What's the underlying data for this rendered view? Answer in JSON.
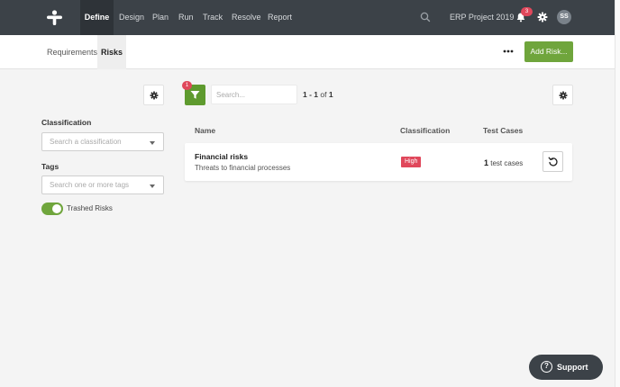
{
  "nav": {
    "items": [
      {
        "label": "Define",
        "active": true
      },
      {
        "label": "Design",
        "active": false
      },
      {
        "label": "Plan",
        "active": false
      },
      {
        "label": "Run",
        "active": false
      },
      {
        "label": "Track",
        "active": false
      },
      {
        "label": "Resolve",
        "active": false
      },
      {
        "label": "Report",
        "active": false
      }
    ],
    "project": "ERP Project 2019",
    "notifications": "3",
    "avatar_initials": "SS",
    "icons": [
      "logo-icon",
      "search-icon",
      "bell-icon",
      "gear-icon"
    ]
  },
  "subheader": {
    "tabs": [
      {
        "label": "Requirements",
        "active": false
      },
      {
        "label": "Risks",
        "active": true
      }
    ],
    "add_label": "Add Risk..."
  },
  "filters": {
    "classification_label": "Classification",
    "classification_placeholder": "Search a classification",
    "tags_label": "Tags",
    "tags_placeholder": "Search one or more tags",
    "trashed_label": "Trashed Risks",
    "trashed_on": true
  },
  "toolbar": {
    "filter_count": "1",
    "search_placeholder": "Search...",
    "pager_range": "1 - 1",
    "pager_of": "of",
    "pager_total": "1"
  },
  "table": {
    "columns": [
      "Name",
      "Classification",
      "Test Cases"
    ],
    "rows": [
      {
        "name": "Financial risks",
        "description": "Threats to financial processes",
        "classification": "High",
        "test_cases_count": "1",
        "test_cases_label": "test cases"
      }
    ]
  },
  "support_label": "Support",
  "colors": {
    "nav_bg": "#3c4248",
    "accent_green": "#6fa53c",
    "badge_red": "#e0475b"
  }
}
